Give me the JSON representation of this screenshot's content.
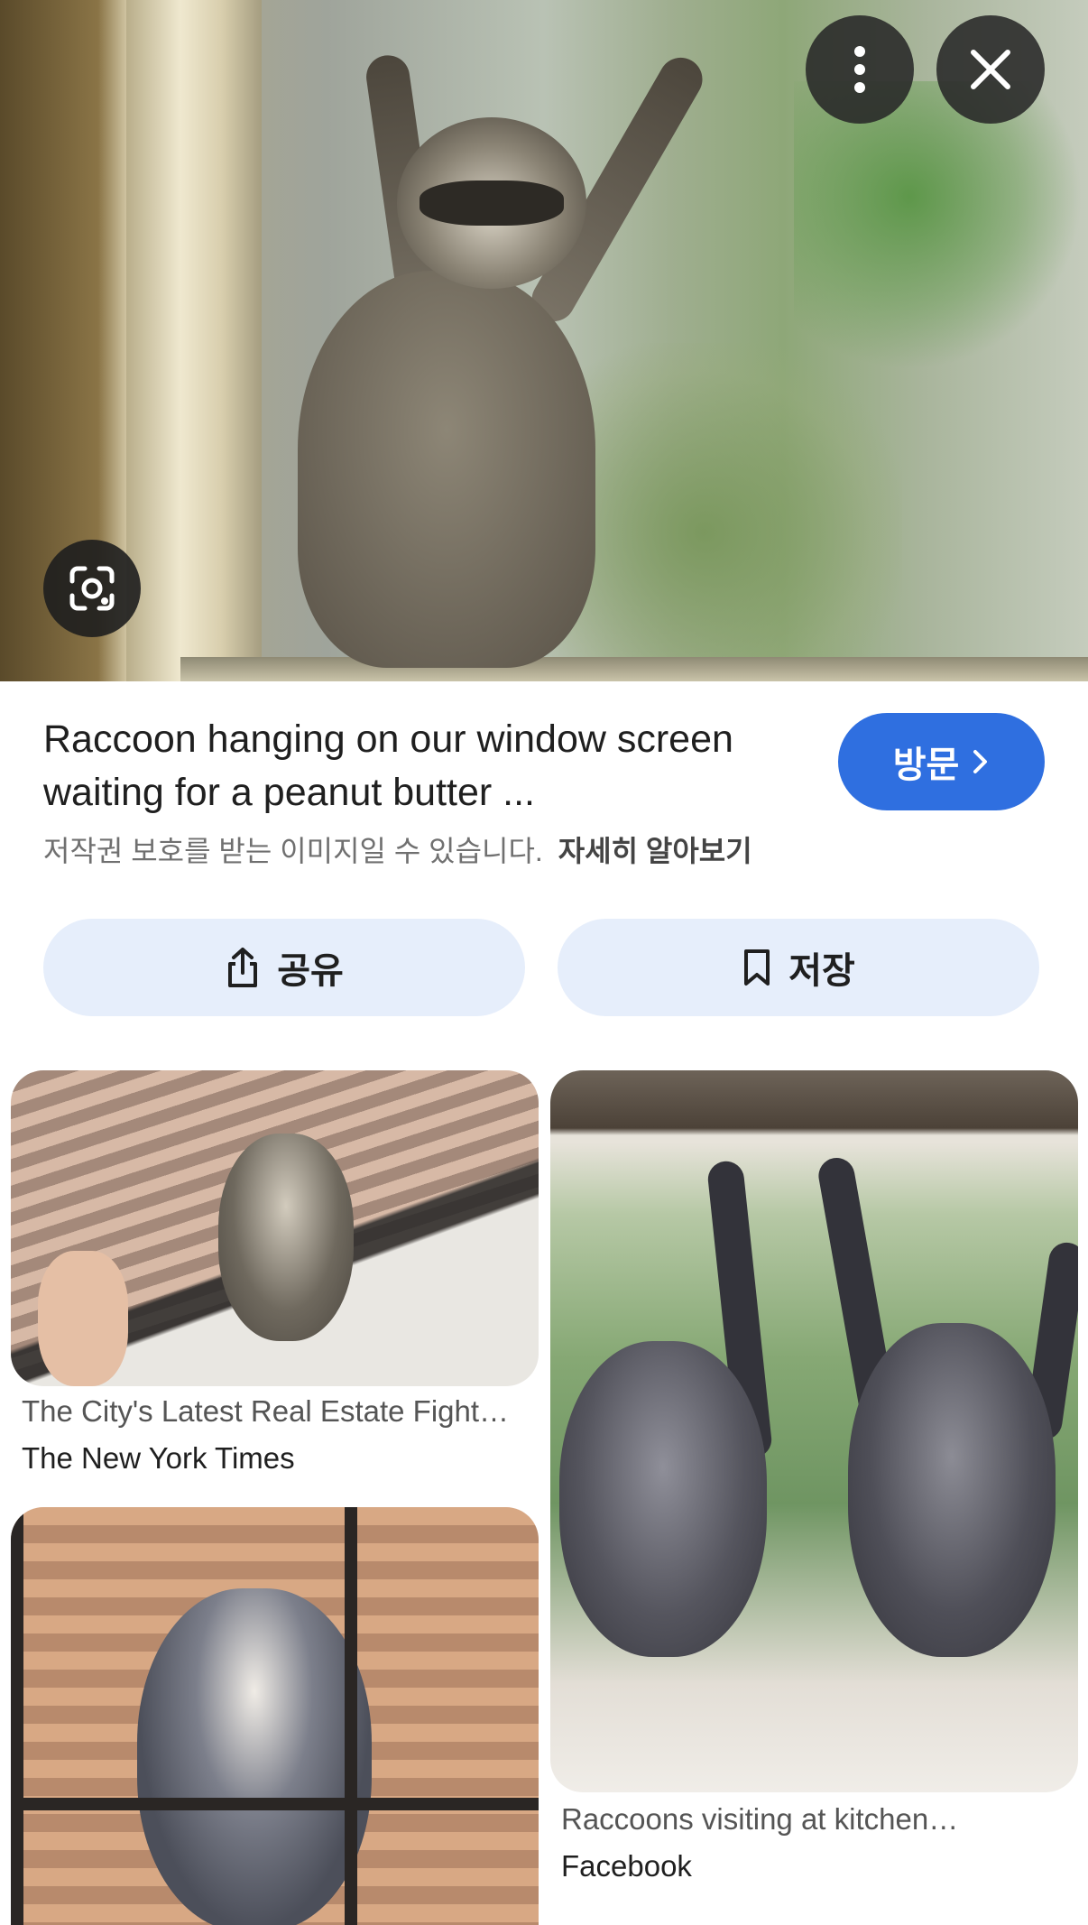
{
  "hero": {
    "more_icon": "more-vertical-icon",
    "close_icon": "close-icon",
    "lens_icon": "lens-icon"
  },
  "info": {
    "title": "Raccoon hanging on our window screen waiting for a peanut butter ...",
    "visit_label": "방문",
    "copyright": "저작권 보호를 받는 이미지일 수 있습니다.",
    "learn_more": "자세히 알아보기"
  },
  "actions": {
    "share_label": "공유",
    "save_label": "저장"
  },
  "results": [
    {
      "title": "The City's Latest Real Estate Fight…",
      "source": "The New York Times"
    },
    {
      "title": "Raccoons visiting at kitchen…",
      "source": "Facebook"
    },
    {
      "title": "",
      "source": ""
    }
  ],
  "colors": {
    "accent": "#2f6fe0",
    "button_bg": "#e6eefb",
    "overlay": "#282828"
  }
}
